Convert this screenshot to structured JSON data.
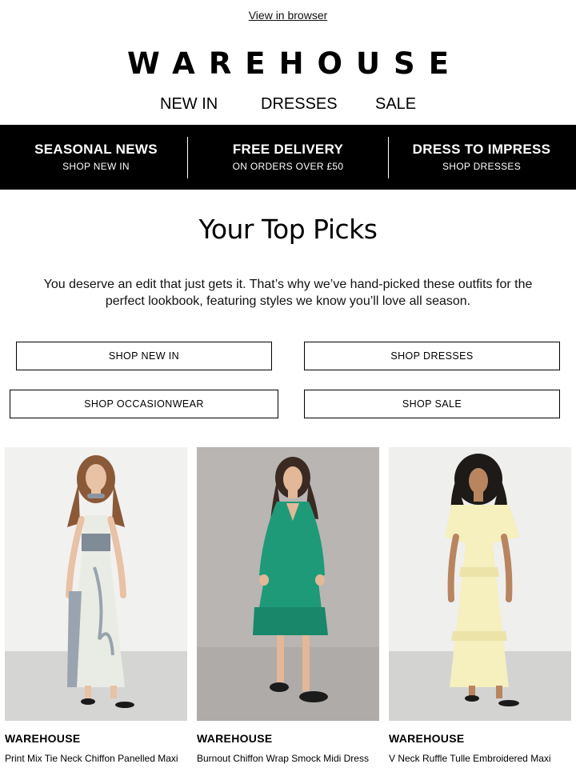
{
  "header": {
    "view_in_browser": "View in browser",
    "logo": "WAREHOUSE",
    "nav": [
      "NEW IN",
      "DRESSES",
      "SALE"
    ]
  },
  "banner": [
    {
      "title": "SEASONAL NEWS",
      "subtitle": "SHOP NEW IN"
    },
    {
      "title": "FREE DELIVERY",
      "subtitle": "ON ORDERS OVER £50"
    },
    {
      "title": "DRESS TO IMPRESS",
      "subtitle": "SHOP DRESSES"
    }
  ],
  "main": {
    "heading": "Your Top Picks",
    "intro": "You deserve an edit that just gets it. That’s why we’ve hand-picked these outfits for the perfect lookbook, featuring styles we know you’ll love all season.",
    "buttons": [
      "SHOP NEW IN",
      "SHOP DRESSES",
      "SHOP OCCASIONWEAR",
      "SHOP SALE"
    ]
  },
  "products": [
    {
      "brand": "WAREHOUSE",
      "name": "Print Mix Tie Neck Chiffon Panelled Maxi"
    },
    {
      "brand": "WAREHOUSE",
      "name": "Burnout Chiffon Wrap Smock Midi Dress"
    },
    {
      "brand": "WAREHOUSE",
      "name": "V Neck Ruffle Tulle Embroidered Maxi"
    }
  ],
  "colors": {
    "banner_bg": "#000000",
    "text": "#111111",
    "dress_1": "#e9ece4",
    "dress_2": "#1f9a78",
    "dress_3": "#f6efbe"
  }
}
